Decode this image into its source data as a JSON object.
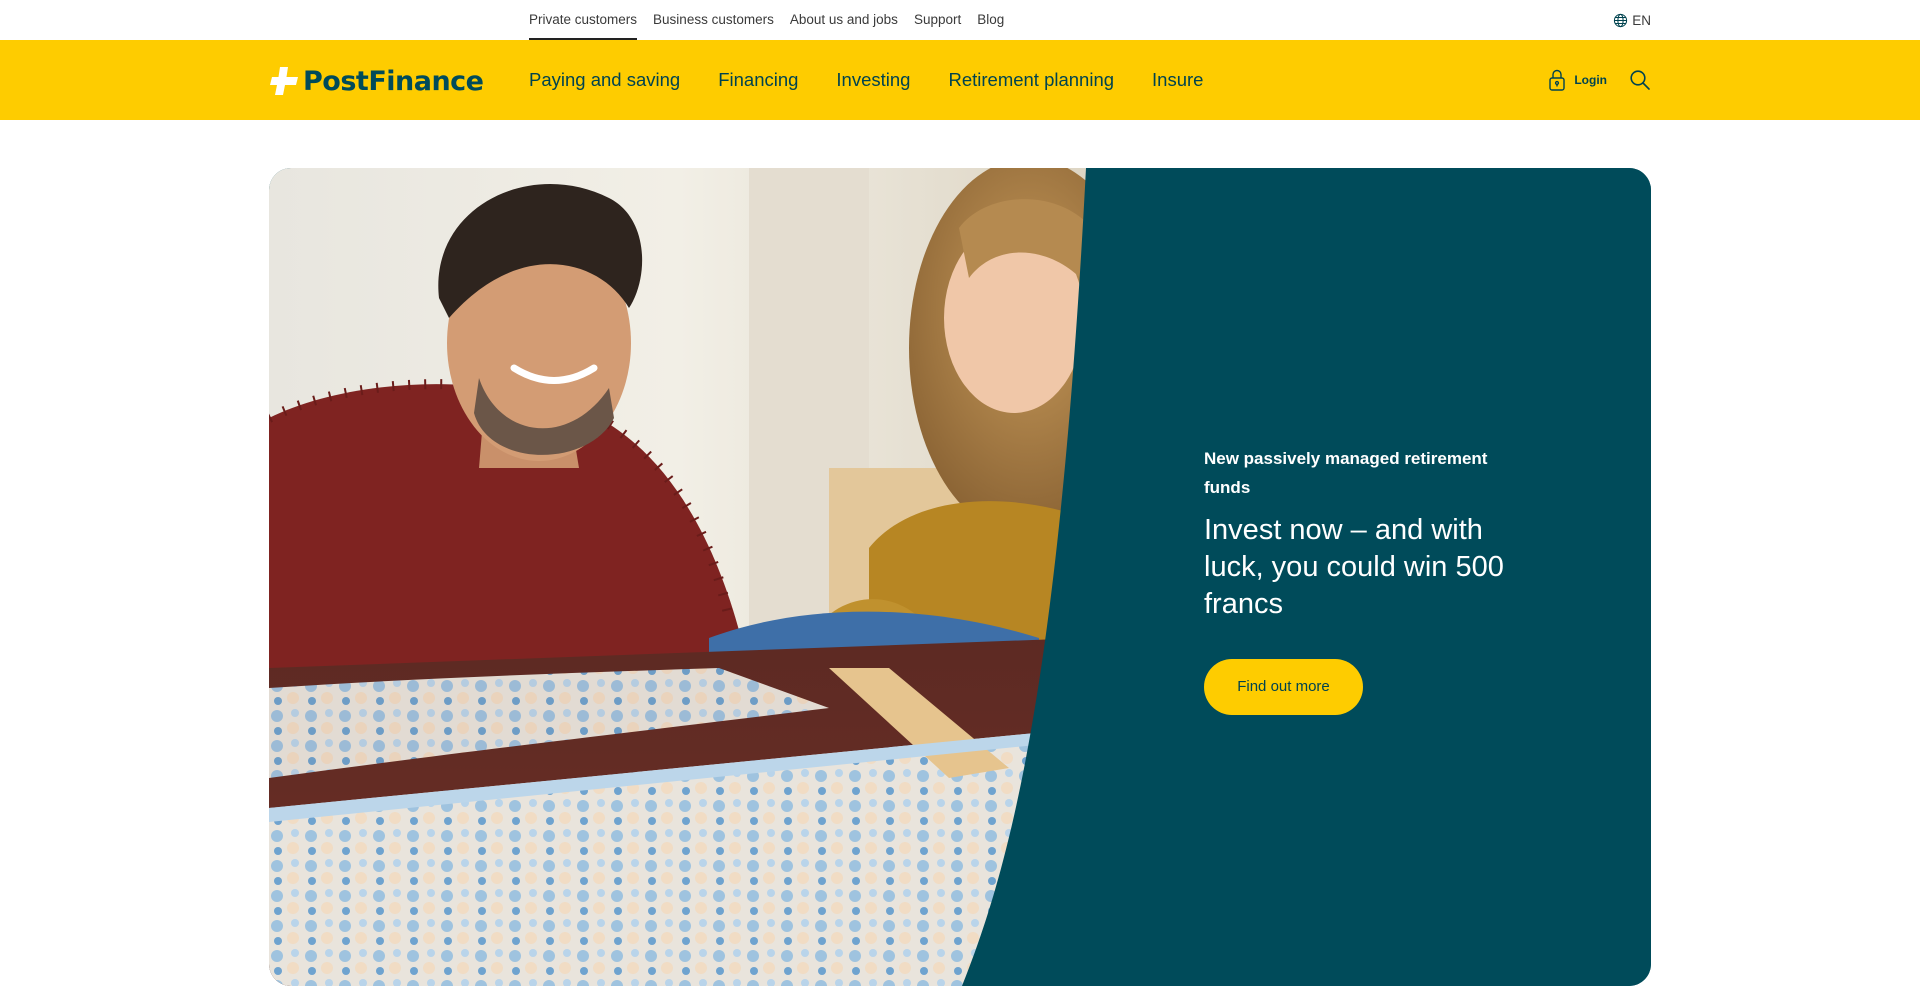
{
  "top_nav": {
    "items": [
      {
        "label": "Private customers",
        "active": true
      },
      {
        "label": "Business customers",
        "active": false
      },
      {
        "label": "About us and jobs",
        "active": false
      },
      {
        "label": "Support",
        "active": false
      },
      {
        "label": "Blog",
        "active": false
      }
    ],
    "language": "EN",
    "language_icon": "globe-icon"
  },
  "header": {
    "brand": "PostFinance",
    "logo_icon": "postfinance-cross-logo",
    "nav": [
      {
        "label": "Paying and saving"
      },
      {
        "label": "Financing"
      },
      {
        "label": "Investing"
      },
      {
        "label": "Retirement planning"
      },
      {
        "label": "Insure"
      }
    ],
    "login_label": "Login",
    "login_icon": "padlock-icon",
    "search_icon": "search-icon"
  },
  "hero": {
    "image_alt": "Father and daughter doing a jigsaw puzzle",
    "kicker": "New passively managed retirement funds",
    "title": "Invest now – and with luck, you could win 500 francs",
    "cta_label": "Find out more"
  },
  "colors": {
    "brand_yellow": "#fecc00",
    "petrol": "#004b5a",
    "text_dark": "#00434f"
  }
}
